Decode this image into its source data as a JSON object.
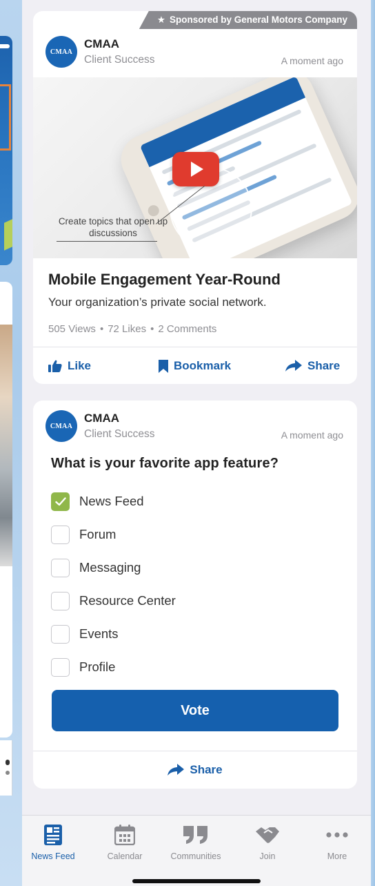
{
  "card1": {
    "sponsor": "Sponsored by General Motors Company",
    "author": {
      "name": "CMAA",
      "role": "Client Success",
      "avatar_text": "CMAA"
    },
    "time": "A moment ago",
    "callout": "Create topics that open up discussions",
    "title": "Mobile Engagement Year-Round",
    "subtitle": "Your organization’s private social network.",
    "stats": {
      "views": "505 Views",
      "likes": "72 Likes",
      "comments": "2 Comments",
      "separator": "•"
    },
    "actions": {
      "like": "Like",
      "bookmark": "Bookmark",
      "share": "Share"
    }
  },
  "card2": {
    "author": {
      "name": "CMAA",
      "role": "Client Success",
      "avatar_text": "CMAA"
    },
    "time": "A moment ago",
    "question": "What is your favorite app feature?",
    "options": [
      {
        "label": "News Feed",
        "checked": true
      },
      {
        "label": "Forum",
        "checked": false
      },
      {
        "label": "Messaging",
        "checked": false
      },
      {
        "label": "Resource Center",
        "checked": false
      },
      {
        "label": "Events",
        "checked": false
      },
      {
        "label": "Profile",
        "checked": false
      }
    ],
    "vote_label": "Vote",
    "share_label": "Share"
  },
  "tabs": [
    {
      "label": "News Feed",
      "icon": "news-feed-icon",
      "active": true
    },
    {
      "label": "Calendar",
      "icon": "calendar-icon",
      "active": false
    },
    {
      "label": "Communities",
      "icon": "quote-icon",
      "active": false
    },
    {
      "label": "Join",
      "icon": "handshake-icon",
      "active": false
    },
    {
      "label": "More",
      "icon": "more-dots-icon",
      "active": false
    }
  ],
  "colors": {
    "brand_blue": "#1560ae",
    "link_blue": "#1a5fa9",
    "check_green": "#90b74a",
    "play_red": "#e03b2e",
    "sponsor_gray": "#8a8a8f"
  }
}
